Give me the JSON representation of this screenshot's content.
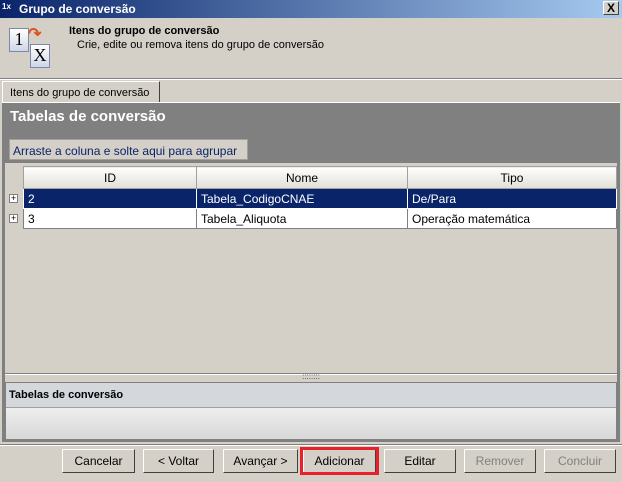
{
  "window": {
    "title": "Grupo de conversão",
    "close_label": "X"
  },
  "header": {
    "title": "Itens do grupo de conversão",
    "subtitle": "Crie, edite ou remova itens do grupo de conversão",
    "icon_from": "1",
    "icon_to": "X"
  },
  "tabs": [
    {
      "label": "Itens do grupo de conversão",
      "active": true
    }
  ],
  "panel": {
    "title": "Tabelas de conversão",
    "group_by_hint": "Arraste a coluna e solte aqui para agrupar"
  },
  "grid": {
    "columns": [
      "ID",
      "Nome",
      "Tipo"
    ],
    "rows": [
      {
        "id": "2",
        "nome": "Tabela_CodigoCNAE",
        "tipo": "De/Para",
        "selected": true
      },
      {
        "id": "3",
        "nome": "Tabela_Aliquota",
        "tipo": "Operação matemática",
        "selected": false
      }
    ],
    "expand_glyph": "+"
  },
  "splitter_grip": "::::::::",
  "lower_panel": {
    "title": "Tabelas de conversão"
  },
  "buttons": {
    "cancel": "Cancelar",
    "back": "< Voltar",
    "next": "Avançar >",
    "add": "Adicionar",
    "edit": "Editar",
    "remove": "Remover",
    "finish": "Concluir"
  },
  "colors": {
    "selection": "#0a246a",
    "highlight": "#e8202a"
  }
}
